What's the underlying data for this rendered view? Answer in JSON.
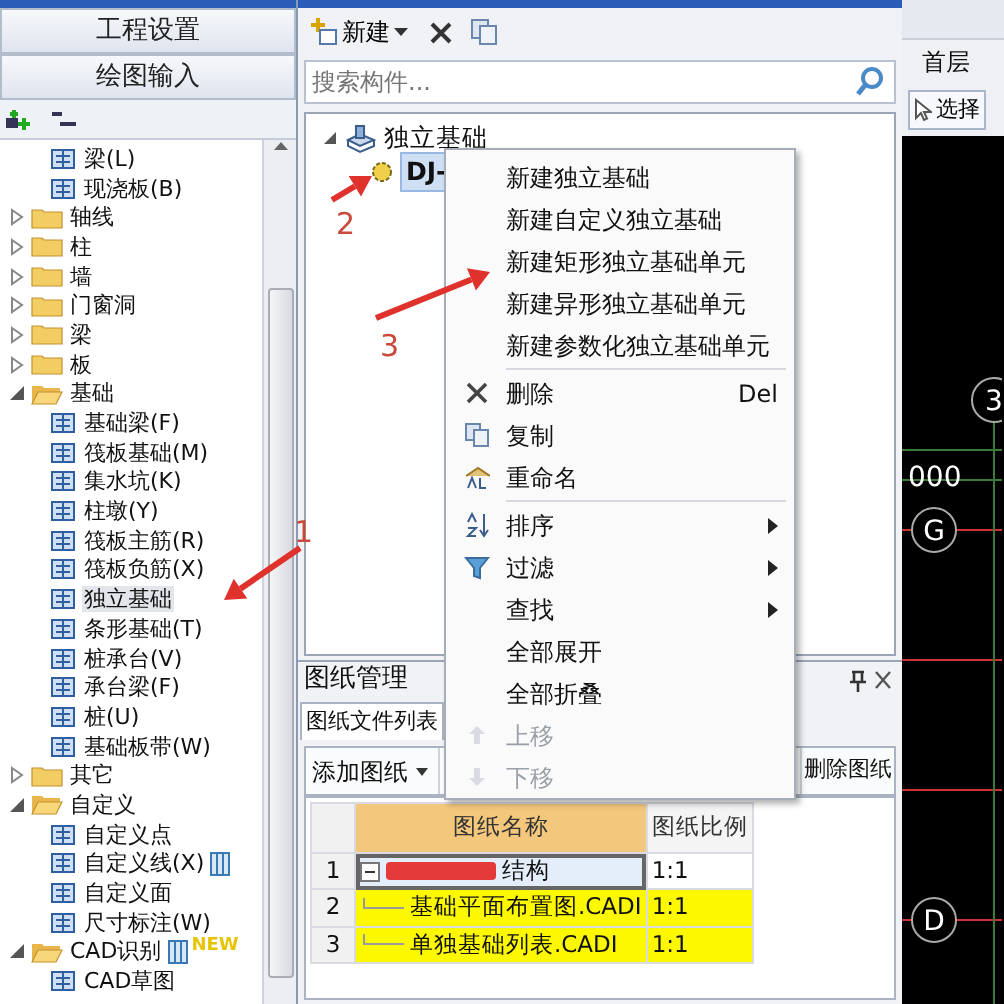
{
  "left_panel": {
    "buttons": [
      {
        "label": "工程设置"
      },
      {
        "label": "绘图输入"
      }
    ],
    "tree": [
      {
        "kind": "continued",
        "children": [
          {
            "kind": "item",
            "label": "梁(L)",
            "selected": false
          },
          {
            "kind": "item",
            "label": "现浇板(B)",
            "selected": false
          }
        ]
      },
      {
        "kind": "folder",
        "label": "轴线",
        "expanded": false
      },
      {
        "kind": "folder",
        "label": "柱",
        "expanded": false
      },
      {
        "kind": "folder",
        "label": "墙",
        "expanded": false
      },
      {
        "kind": "folder",
        "label": "门窗洞",
        "expanded": false
      },
      {
        "kind": "folder",
        "label": "梁",
        "expanded": false
      },
      {
        "kind": "folder",
        "label": "板",
        "expanded": false
      },
      {
        "kind": "folder",
        "label": "基础",
        "expanded": true,
        "children": [
          {
            "kind": "item",
            "label": "基础梁(F)",
            "selected": false
          },
          {
            "kind": "item",
            "label": "筏板基础(M)",
            "selected": false
          },
          {
            "kind": "item",
            "label": "集水坑(K)",
            "selected": false
          },
          {
            "kind": "item",
            "label": "柱墩(Y)",
            "selected": false
          },
          {
            "kind": "item",
            "label": "筏板主筋(R)",
            "selected": false
          },
          {
            "kind": "item",
            "label": "筏板负筋(X)",
            "selected": false
          },
          {
            "kind": "item",
            "label": "独立基础",
            "selected": true
          },
          {
            "kind": "item",
            "label": "条形基础(T)",
            "selected": false
          },
          {
            "kind": "item",
            "label": "桩承台(V)",
            "selected": false
          },
          {
            "kind": "item",
            "label": "承台梁(F)",
            "selected": false
          },
          {
            "kind": "item",
            "label": "桩(U)",
            "selected": false
          },
          {
            "kind": "item",
            "label": "基础板带(W)",
            "selected": false
          }
        ]
      },
      {
        "kind": "folder",
        "label": "其它",
        "expanded": false
      },
      {
        "kind": "folder",
        "label": "自定义",
        "expanded": true,
        "children": [
          {
            "kind": "item",
            "label": "自定义点",
            "selected": false
          },
          {
            "kind": "item",
            "label": "自定义线(X)",
            "selected": false,
            "panel_icon": true
          },
          {
            "kind": "item",
            "label": "自定义面",
            "selected": false
          },
          {
            "kind": "item",
            "label": "尺寸标注(W)",
            "selected": false
          }
        ]
      },
      {
        "kind": "folder",
        "label": "CAD识别",
        "expanded": true,
        "panel_icon": true,
        "badge": "NEW",
        "children": [
          {
            "kind": "item",
            "label": "CAD草图",
            "selected": false
          }
        ]
      }
    ]
  },
  "component_panel": {
    "new_button": "新建",
    "search": {
      "placeholder": "搜索构件..."
    },
    "tree": [
      {
        "label": "独立基础",
        "expanded": true,
        "children": [
          {
            "label": "DJ-",
            "selected": true
          }
        ]
      }
    ]
  },
  "context_menu": [
    {
      "kind": "plain",
      "label": "新建独立基础",
      "disabled": false
    },
    {
      "kind": "plain",
      "label": "新建自定义独立基础",
      "disabled": false
    },
    {
      "kind": "plain",
      "label": "新建矩形独立基础单元",
      "disabled": false
    },
    {
      "kind": "plain",
      "label": "新建异形独立基础单元",
      "disabled": false
    },
    {
      "kind": "plain",
      "label": "新建参数化独立基础单元",
      "disabled": false
    },
    {
      "kind": "separator"
    },
    {
      "kind": "delete",
      "label": "删除",
      "shortcut": "Del",
      "disabled": false
    },
    {
      "kind": "copy",
      "label": "复制",
      "disabled": false
    },
    {
      "kind": "rename",
      "label": "重命名",
      "disabled": false
    },
    {
      "kind": "separator"
    },
    {
      "kind": "sort",
      "label": "排序",
      "submenu": true,
      "disabled": false
    },
    {
      "kind": "filter",
      "label": "过滤",
      "submenu": true,
      "disabled": false
    },
    {
      "kind": "plain",
      "label": "查找",
      "submenu": true,
      "disabled": false
    },
    {
      "kind": "plain",
      "label": "全部展开",
      "disabled": false
    },
    {
      "kind": "plain",
      "label": "全部折叠",
      "disabled": false
    },
    {
      "kind": "up",
      "label": "上移",
      "disabled": true
    },
    {
      "kind": "down",
      "label": "下移",
      "disabled": true
    }
  ],
  "drawing_panel": {
    "title": "图纸管理",
    "tabs": [
      {
        "label": "图纸文件列表",
        "selected": true
      }
    ],
    "toolbar": [
      {
        "label": "添加图纸",
        "dropdown": true
      },
      {
        "label": "删除图纸"
      }
    ],
    "table": {
      "columns": [
        "图纸名称",
        "图纸比例"
      ],
      "rows": [
        {
          "index": "1",
          "kind": "group",
          "name": "结构",
          "scale": "1:1",
          "redacted": true,
          "highlight": false,
          "selected": true
        },
        {
          "index": "2",
          "kind": "file",
          "name": "基础平面布置图.CADI",
          "scale": "1:1",
          "highlight": true,
          "selected": false
        },
        {
          "index": "3",
          "kind": "file",
          "name": "单独基础列表.CADI",
          "scale": "1:1",
          "highlight": true,
          "selected": false
        }
      ]
    }
  },
  "right_panel": {
    "floor": "首层",
    "select_button": "选择",
    "axis_labels": [
      "3",
      "000",
      "G",
      "D"
    ]
  },
  "annotations": [
    {
      "label": "1"
    },
    {
      "label": "2"
    },
    {
      "label": "3"
    }
  ]
}
